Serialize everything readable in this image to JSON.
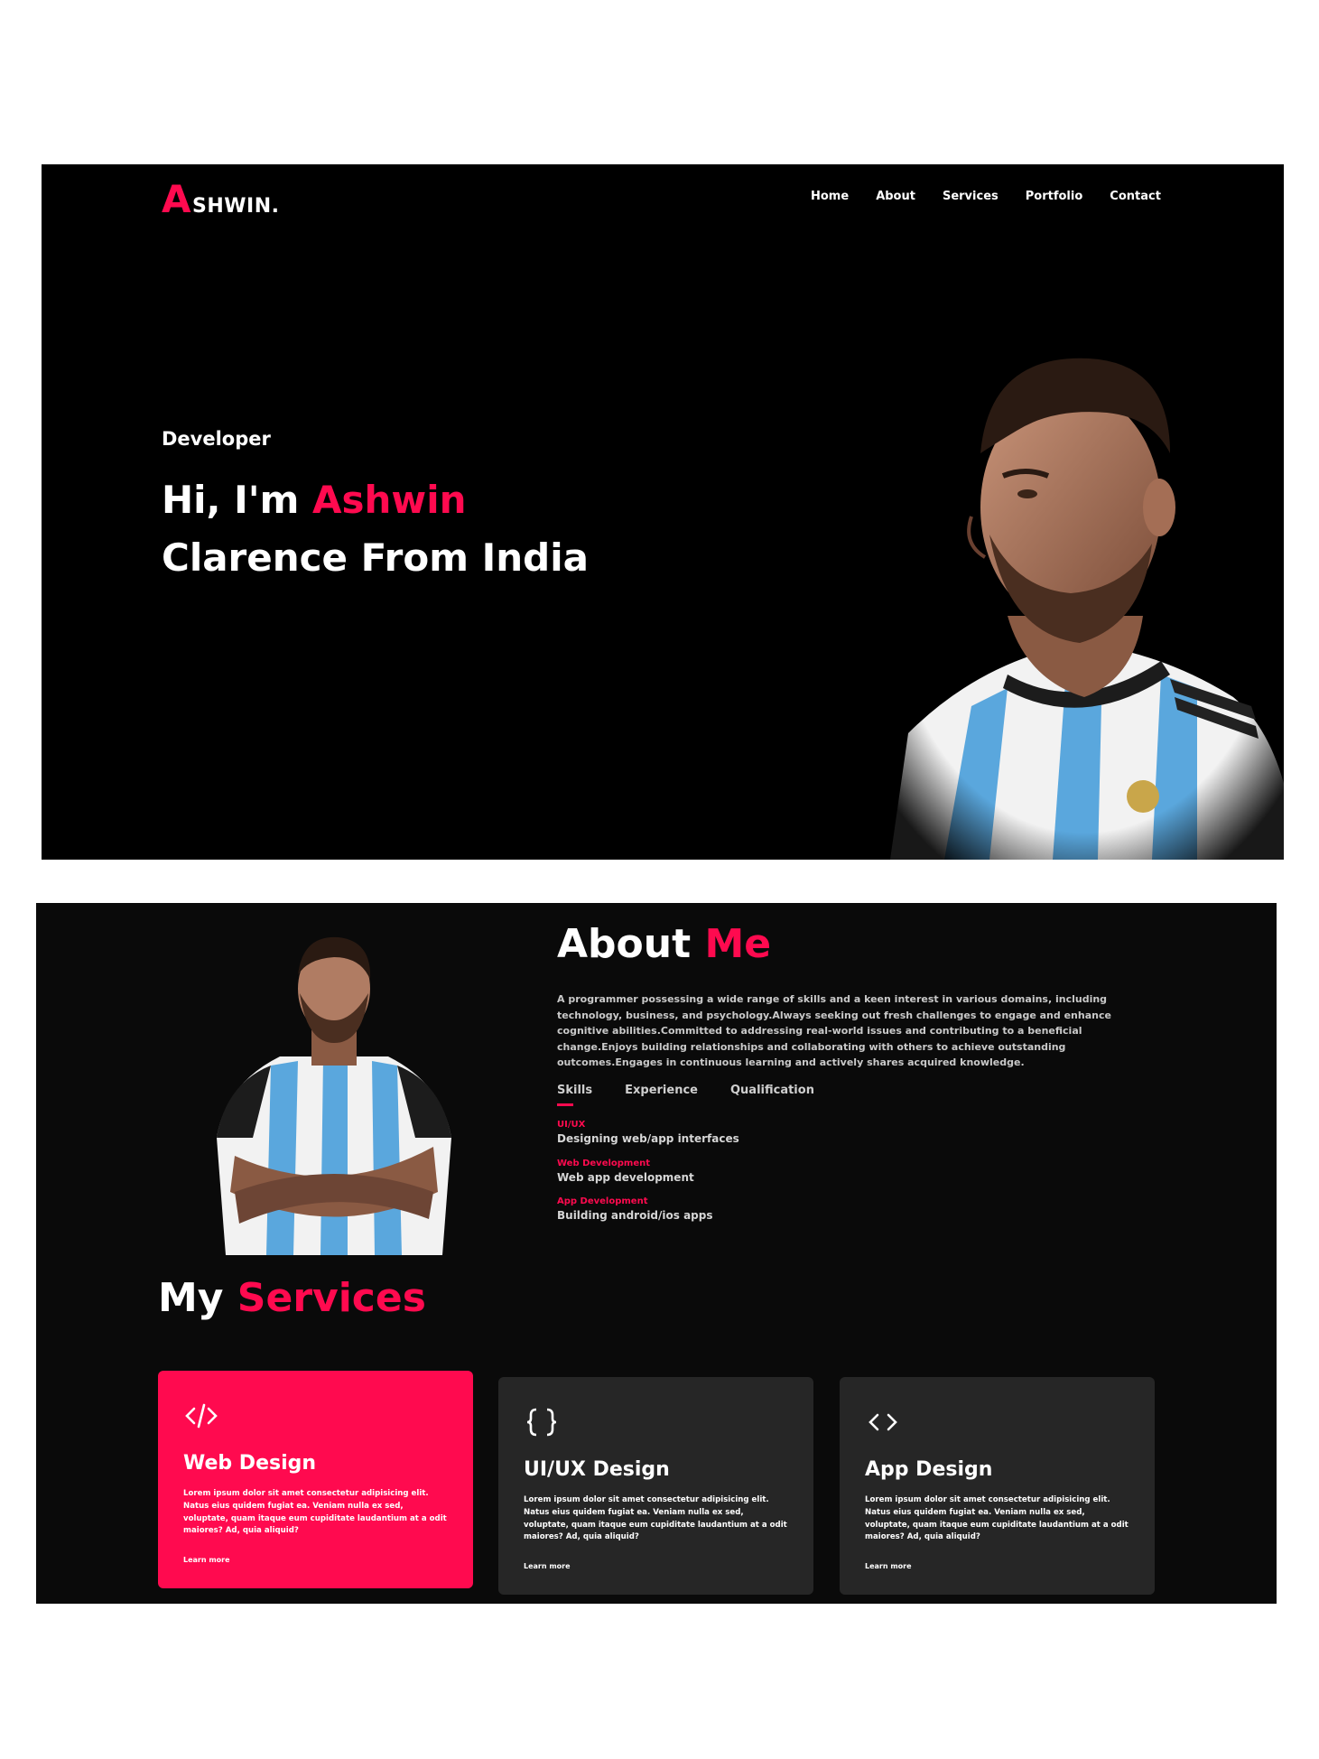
{
  "brand": {
    "logo_initial": "A",
    "logo_rest": "SHWIN."
  },
  "nav": [
    "Home",
    "About",
    "Services",
    "Portfolio",
    "Contact"
  ],
  "hero": {
    "subtitle": "Developer",
    "greeting_prefix": "Hi, I'm ",
    "greeting_name": "Ashwin",
    "line2": "Clarence From India"
  },
  "about": {
    "title_part1": "About ",
    "title_part2": "Me",
    "text": "A programmer possessing a wide range of skills and a keen interest in various domains, including technology, business, and psychology.Always seeking out fresh challenges to engage and enhance cognitive abilities.Committed to addressing real-world issues and contributing to a beneficial change.Enjoys building relationships and collaborating with others to achieve outstanding outcomes.Engages in continuous learning and actively shares acquired knowledge.",
    "tabs": [
      "Skills",
      "Experience",
      "Qualification"
    ],
    "skills": [
      {
        "category": "UI/UX",
        "description": "Designing web/app interfaces"
      },
      {
        "category": "Web Development",
        "description": "Web app development"
      },
      {
        "category": "App Development",
        "description": "Building android/ios apps"
      }
    ]
  },
  "services": {
    "title_part1": "My ",
    "title_part2": "Services",
    "cards": [
      {
        "icon": "code-slash-icon",
        "title": "Web Design",
        "text": "Lorem ipsum dolor sit amet consectetur adipisicing elit. Natus eius quidem fugiat ea. Veniam nulla ex sed, voluptate, quam itaque eum cupiditate laudantium at a odit maiores? Ad, quia aliquid?",
        "link": "Learn more"
      },
      {
        "icon": "curly-braces-icon",
        "title": "UI/UX Design",
        "text": "Lorem ipsum dolor sit amet consectetur adipisicing elit. Natus eius quidem fugiat ea. Veniam nulla ex sed, voluptate, quam itaque eum cupiditate laudantium at a odit maiores? Ad, quia aliquid?",
        "link": "Learn more"
      },
      {
        "icon": "angle-brackets-icon",
        "title": "App Design",
        "text": "Lorem ipsum dolor sit amet consectetur adipisicing elit. Natus eius quidem fugiat ea. Veniam nulla ex sed, voluptate, quam itaque eum cupiditate laudantium at a odit maiores? Ad, quia aliquid?",
        "link": "Learn more"
      }
    ]
  },
  "colors": {
    "accent": "#ff0a4f",
    "hero_bg": "#000000",
    "section_bg": "#0a0a0a",
    "card_bg": "#262626"
  }
}
